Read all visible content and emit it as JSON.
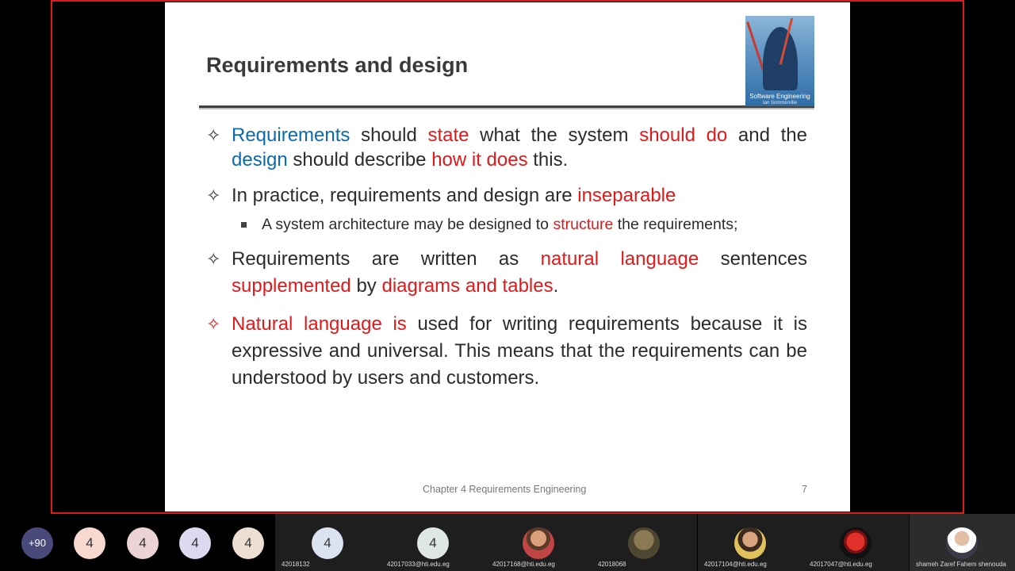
{
  "slide": {
    "title": "Requirements and design",
    "book": {
      "caption": "Software Engineering",
      "author": "Ian Sommerville"
    },
    "bullets": [
      {
        "parts": [
          {
            "text": "Requirements",
            "color": "blue"
          },
          {
            "text": " should ",
            "color": "normal"
          },
          {
            "text": "state",
            "color": "red"
          },
          {
            "text": " what the system ",
            "color": "normal"
          },
          {
            "text": "should do",
            "color": "red"
          },
          {
            "text": " and the ",
            "color": "normal"
          },
          {
            "text": "design",
            "color": "blue"
          },
          {
            "text": " should describe ",
            "color": "normal"
          },
          {
            "text": "how it does",
            "color": "red"
          },
          {
            "text": " this.",
            "color": "normal"
          }
        ]
      },
      {
        "parts": [
          {
            "text": "In practice, requirements and design are ",
            "color": "normal"
          },
          {
            "text": "inseparable",
            "color": "red"
          }
        ],
        "sub": [
          {
            "text": "A system architecture may be designed to ",
            "color": "normal"
          },
          {
            "text": "structure",
            "color": "red"
          },
          {
            "text": " the requirements;",
            "color": "normal"
          }
        ]
      },
      {
        "parts": [
          {
            "text": "Requirements are written as ",
            "color": "normal"
          },
          {
            "text": "natural language",
            "color": "red"
          },
          {
            "text": " sentences ",
            "color": "normal"
          },
          {
            "text": "supplemented",
            "color": "red"
          },
          {
            "text": " by ",
            "color": "normal"
          },
          {
            "text": "diagrams and tables",
            "color": "red"
          },
          {
            "text": ".",
            "color": "normal"
          }
        ]
      },
      {
        "parts": [
          {
            "text": "Natural language is",
            "color": "red"
          },
          {
            "text": " used for writing requirements because it is expressive and universal. This means that the requirements  can be understood by users and customers.",
            "color": "normal"
          }
        ]
      }
    ],
    "footer": "Chapter 4 Requirements Engineering",
    "page_number": "7",
    "marker_glyph": "✧"
  },
  "participants": {
    "more_count": "+90",
    "avatars": [
      {
        "label": "4",
        "bg": "#f7d9cf"
      },
      {
        "label": "4",
        "bg": "#ecd3d6"
      },
      {
        "label": "4",
        "bg": "#dddaf0"
      },
      {
        "label": "4",
        "bg": "#ecdfd2"
      }
    ],
    "tiles": [
      {
        "name": "42018132",
        "label": "4",
        "bg": "#dbe3f1"
      },
      {
        "name": "42017033@hti.edu.eg",
        "label": "4",
        "bg": "#dfe6e6"
      },
      {
        "name": "42017168@hti.edu.eg",
        "label": "",
        "photo": "photo"
      },
      {
        "name": "42018068",
        "label": "",
        "photo": "photo2"
      },
      {
        "name": "42017104@hti.edu.eg",
        "label": "",
        "photo": "photo3"
      },
      {
        "name": "42017047@hti.edu.eg",
        "label": "",
        "photo": "photo4"
      },
      {
        "name": "shameh Zaref Fahem shenouda",
        "label": "",
        "photo": "photo5"
      }
    ]
  },
  "colors": {
    "share_border": "#e0191b",
    "emphasis_red": "#e0191b",
    "emphasis_blue": "#0a6ab0"
  }
}
